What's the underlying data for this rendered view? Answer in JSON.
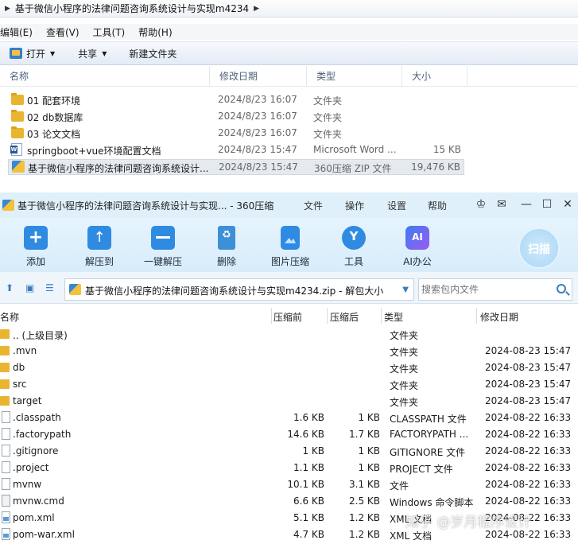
{
  "explorer": {
    "address": {
      "crumb": "基于微信小程序的法律问题咨询系统设计与实现m4234"
    },
    "menu": [
      "编辑(E)",
      "查看(V)",
      "工具(T)",
      "帮助(H)"
    ],
    "toolbar": {
      "open": "打开",
      "share": "共享",
      "new_folder": "新建文件夹"
    },
    "columns": {
      "name": "名称",
      "date": "修改日期",
      "type": "类型",
      "size": "大小"
    },
    "files": [
      {
        "icon": "folder-icon",
        "name": "01 配套环境",
        "date": "2024/8/23 16:07",
        "type": "文件夹",
        "size": ""
      },
      {
        "icon": "folder-icon",
        "name": "02 db数据库",
        "date": "2024/8/23 16:07",
        "type": "文件夹",
        "size": ""
      },
      {
        "icon": "folder-icon",
        "name": "03 论文文档",
        "date": "2024/8/23 16:07",
        "type": "文件夹",
        "size": ""
      },
      {
        "icon": "word-doc-icon",
        "name": "springboot+vue环境配置文档",
        "date": "2024/8/23 15:47",
        "type": "Microsoft Word ...",
        "size": "15 KB"
      },
      {
        "icon": "zip-archive-icon",
        "name": "基于微信小程序的法律问题咨询系统设计...",
        "date": "2024/8/23 15:47",
        "type": "360压缩 ZIP 文件",
        "size": "19,476 KB"
      }
    ]
  },
  "zip": {
    "title": "基于微信小程序的法律问题咨询系统设计与实现... - 360压缩",
    "menu": [
      "文件",
      "操作",
      "设置",
      "帮助"
    ],
    "tools": [
      {
        "icon": "add-icon",
        "label": "添加"
      },
      {
        "icon": "extract-to-icon",
        "label": "解压到"
      },
      {
        "icon": "one-click-extract-icon",
        "label": "一键解压"
      },
      {
        "icon": "delete-icon",
        "label": "删除"
      },
      {
        "icon": "image-compress-icon",
        "label": "图片压缩"
      },
      {
        "icon": "tools-icon",
        "label": "工具"
      },
      {
        "icon": "ai-office-icon",
        "label": "AI办公"
      }
    ],
    "scan": "扫描",
    "path": "基于微信小程序的法律问题咨询系统设计与实现m4234.zip - 解包大小",
    "search_placeholder": "搜索包内文件",
    "columns": {
      "name": "名称",
      "packed": "压缩前",
      "compressed": "压缩后",
      "type": "类型",
      "date": "修改日期"
    },
    "entries": [
      {
        "icon": "folder-icon",
        "name": ".. (上级目录)",
        "packed": "",
        "compressed": "",
        "type": "文件夹",
        "date": ""
      },
      {
        "icon": "folder-icon",
        "name": ".mvn",
        "packed": "",
        "compressed": "",
        "type": "文件夹",
        "date": "2024-08-23 15:47"
      },
      {
        "icon": "folder-icon",
        "name": "db",
        "packed": "",
        "compressed": "",
        "type": "文件夹",
        "date": "2024-08-23 15:47"
      },
      {
        "icon": "folder-icon",
        "name": "src",
        "packed": "",
        "compressed": "",
        "type": "文件夹",
        "date": "2024-08-23 15:47"
      },
      {
        "icon": "folder-icon",
        "name": "target",
        "packed": "",
        "compressed": "",
        "type": "文件夹",
        "date": "2024-08-23 15:47"
      },
      {
        "icon": "file-icon",
        "name": ".classpath",
        "packed": "1.6 KB",
        "compressed": "1 KB",
        "type": "CLASSPATH 文件",
        "date": "2024-08-22 16:33"
      },
      {
        "icon": "file-icon",
        "name": ".factorypath",
        "packed": "14.6 KB",
        "compressed": "1.7 KB",
        "type": "FACTORYPATH ...",
        "date": "2024-08-22 16:33"
      },
      {
        "icon": "file-icon",
        "name": ".gitignore",
        "packed": "1 KB",
        "compressed": "1 KB",
        "type": "GITIGNORE 文件",
        "date": "2024-08-22 16:33"
      },
      {
        "icon": "file-icon",
        "name": ".project",
        "packed": "1.1 KB",
        "compressed": "1 KB",
        "type": "PROJECT 文件",
        "date": "2024-08-22 16:33"
      },
      {
        "icon": "file-icon",
        "name": "mvnw",
        "packed": "10.1 KB",
        "compressed": "3.1 KB",
        "type": "文件",
        "date": "2024-08-22 16:33"
      },
      {
        "icon": "cmd-file-icon",
        "name": "mvnw.cmd",
        "packed": "6.6 KB",
        "compressed": "2.5 KB",
        "type": "Windows 命令脚本",
        "date": "2024-08-22 16:33"
      },
      {
        "icon": "xml-file-icon",
        "name": "pom.xml",
        "packed": "5.1 KB",
        "compressed": "1.2 KB",
        "type": "XML 文档",
        "date": "2024-08-22 16:33"
      },
      {
        "icon": "xml-file-icon",
        "name": "pom-war.xml",
        "packed": "4.7 KB",
        "compressed": "1.2 KB",
        "type": "XML 文档",
        "date": "2024-08-22 16:33"
      }
    ],
    "watermark": "知乎 @岁月程序设计"
  }
}
